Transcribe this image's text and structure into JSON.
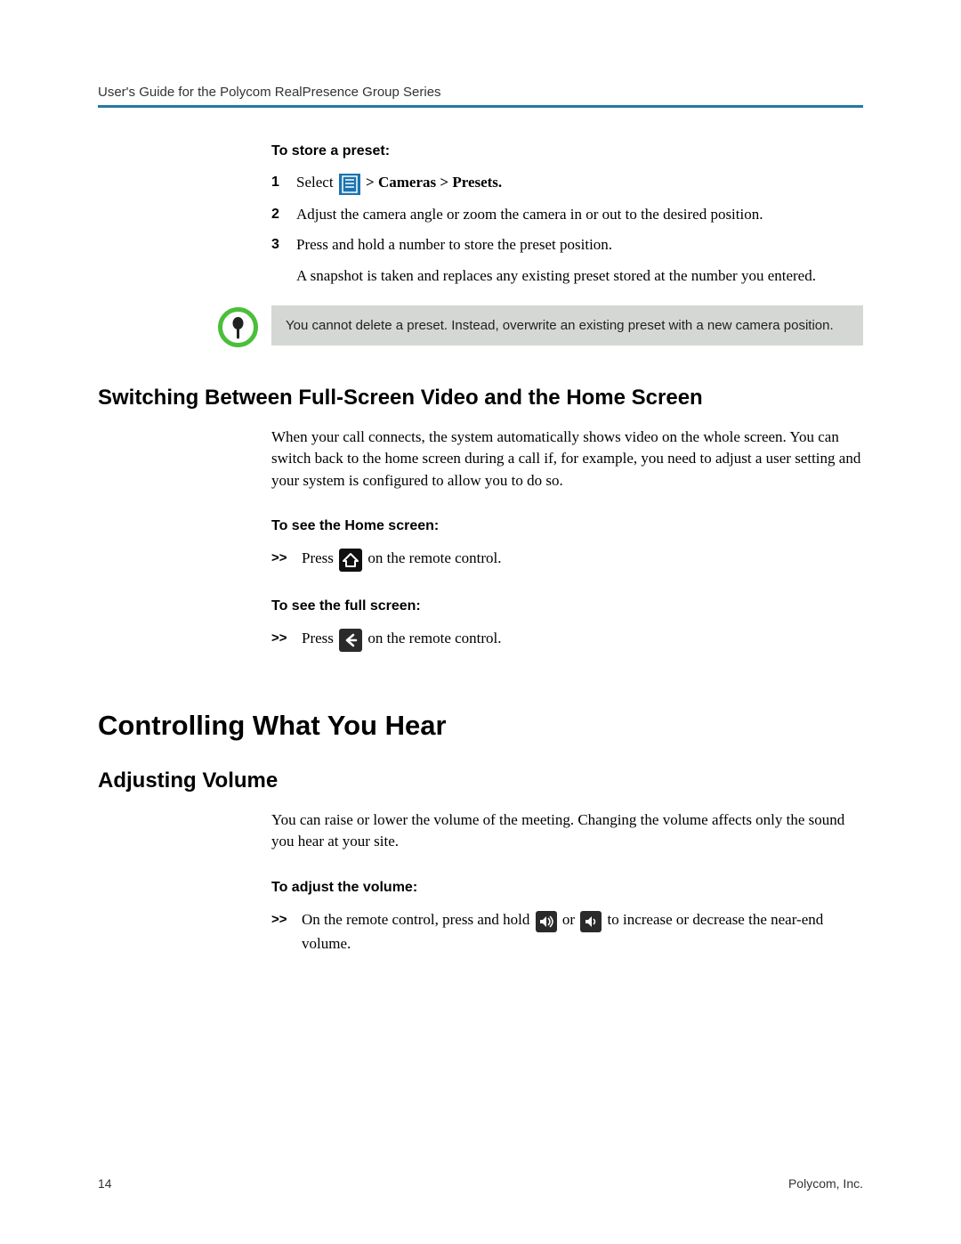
{
  "header": "User's Guide for the Polycom RealPresence Group Series",
  "section_store": {
    "label": "To store a preset:",
    "steps": [
      {
        "num": "1",
        "pre": "Select ",
        "post": " > Cameras > Presets."
      },
      {
        "num": "2",
        "text": "Adjust the camera angle or zoom the camera in or out to the desired position."
      },
      {
        "num": "3",
        "text": "Press and hold a number to store the preset position."
      }
    ],
    "followup": "A snapshot is taken and replaces any existing preset stored at the number you entered."
  },
  "note": "You cannot delete a preset. Instead, overwrite an existing preset with a new camera position.",
  "h2_switch": "Switching Between Full-Screen Video and the Home Screen",
  "para_switch": "When your call connects, the system automatically shows video on the whole screen. You can switch back to the home screen during a call if, for example, you need to adjust a user setting and your system is configured to allow you to do so.",
  "label_home": "To see the Home screen:",
  "row_home_pre": "Press ",
  "row_home_post": " on the remote control.",
  "label_full": "To see the full screen:",
  "row_full_pre": "Press ",
  "row_full_post": " on the remote control.",
  "h1_hear": "Controlling What You Hear",
  "h2_volume": "Adjusting Volume",
  "para_volume": "You can raise or lower the volume of the meeting. Changing the volume affects only the sound you hear at your site.",
  "label_adjust": "To adjust the volume:",
  "row_adjust_pre": "On the remote control, press and hold ",
  "row_adjust_mid": " or ",
  "row_adjust_post": " to increase or decrease the near-end volume.",
  "bullet": ">>",
  "footer_left": "14",
  "footer_right": "Polycom, Inc."
}
